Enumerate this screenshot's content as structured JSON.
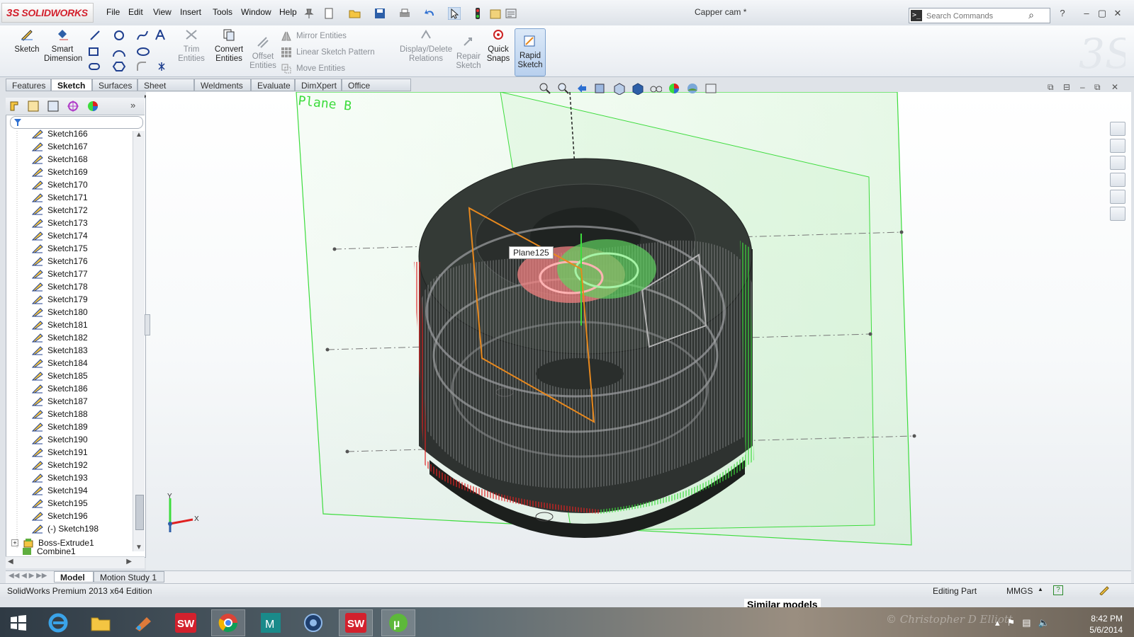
{
  "app": {
    "brand": "SOLIDWORKS",
    "document_title": "Capper cam *",
    "menu": [
      "File",
      "Edit",
      "View",
      "Insert",
      "Tools",
      "Window",
      "Help"
    ],
    "search_placeholder": "Search Commands"
  },
  "toolbar": {
    "sketch": "Sketch",
    "smart_dimension": [
      "Smart",
      "Dimension"
    ],
    "trim_entities": [
      "Trim",
      "Entities"
    ],
    "convert_entities": [
      "Convert",
      "Entities"
    ],
    "offset_entities": [
      "Offset",
      "Entities"
    ],
    "mirror_entities": "Mirror Entities",
    "linear_sketch_pattern": "Linear Sketch Pattern",
    "move_entities": "Move Entities",
    "display_delete_relations": [
      "Display/Delete",
      "Relations"
    ],
    "repair_sketch": [
      "Repair",
      "Sketch"
    ],
    "quick_snaps": [
      "Quick",
      "Snaps"
    ],
    "rapid_sketch": [
      "Rapid",
      "Sketch"
    ]
  },
  "tabs": [
    "Features",
    "Sketch",
    "Surfaces",
    "Sheet Metal",
    "Weldments",
    "Evaluate",
    "DimXpert",
    "Office Products"
  ],
  "active_tab": "Sketch",
  "tree": {
    "items": [
      "Sketch166",
      "Sketch167",
      "Sketch168",
      "Sketch169",
      "Sketch170",
      "Sketch171",
      "Sketch172",
      "Sketch173",
      "Sketch174",
      "Sketch175",
      "Sketch176",
      "Sketch177",
      "Sketch178",
      "Sketch179",
      "Sketch180",
      "Sketch181",
      "Sketch182",
      "Sketch183",
      "Sketch184",
      "Sketch185",
      "Sketch186",
      "Sketch187",
      "Sketch188",
      "Sketch189",
      "Sketch190",
      "Sketch191",
      "Sketch192",
      "Sketch193",
      "Sketch194",
      "Sketch195",
      "Sketch196",
      "(-) Sketch198"
    ],
    "boss_extrude": "Boss-Extrude1",
    "combine": "Combine1"
  },
  "viewport": {
    "plane_label": "Plane B",
    "tooltip": "Plane125",
    "axis_y": "Y",
    "axis_x": "X"
  },
  "bottom_tabs": [
    "Model",
    "Motion Study 1"
  ],
  "status": {
    "edition": "SolidWorks Premium 2013 x64 Edition",
    "mode": "Editing Part",
    "units": "MMGS"
  },
  "overlay_text": "Similar models",
  "taskbar": {
    "time": "8:42 PM",
    "date": "5/6/2014",
    "watermark": "© Christopher D Elliott"
  },
  "colors": {
    "brand_red": "#d3212d",
    "plane_green": "#3ddc3d",
    "wire_red": "#e02020",
    "sketch_orange": "#e8891e",
    "body_dark": "#2c302d"
  }
}
